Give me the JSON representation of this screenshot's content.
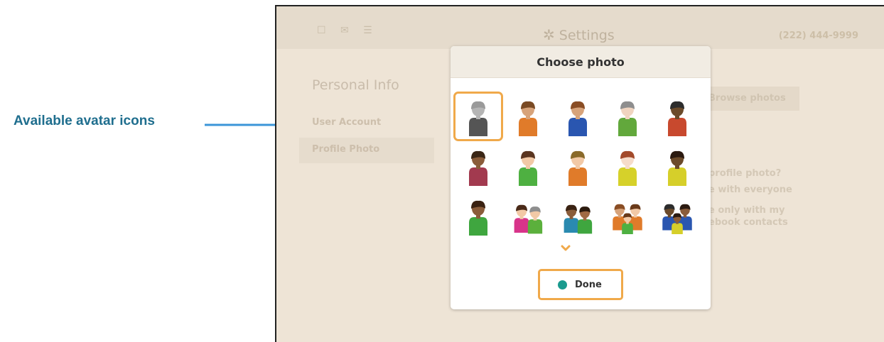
{
  "annotation": {
    "label": "Available avatar icons"
  },
  "app": {
    "title": "Settings",
    "phone": "(222) 444-9999",
    "top_icons": "☐ ✉ ☰",
    "sidebar_heading": "Personal Info",
    "sidebar_items": [
      "User Account",
      "Profile Photo"
    ],
    "browse_button": "Browse photos",
    "privacy_question": "profile photo?",
    "privacy_option_1": "e with everyone",
    "privacy_option_2_line1": "e only with my",
    "privacy_option_2_line2": "ebook contacts"
  },
  "dialog": {
    "title": "Choose photo",
    "done_label": "Done",
    "selected_index": 0,
    "avatars": [
      {
        "name": "default-gray-avatar",
        "kind": "default",
        "skin": "#b5b5b5",
        "hair": "#9a9a9a",
        "shirt": "#555555"
      },
      {
        "name": "avatar-brown-hair-orange-shirt",
        "kind": "single",
        "skin": "#d7a37a",
        "hair": "#7a4a24",
        "shirt": "#e07b2a"
      },
      {
        "name": "avatar-brown-hair-blue-shirt",
        "kind": "single",
        "skin": "#d7a37a",
        "hair": "#8a4d24",
        "shirt": "#2a56b0"
      },
      {
        "name": "avatar-gray-hair-green-shirt",
        "kind": "single",
        "skin": "#f0d4c0",
        "hair": "#8e8e8e",
        "shirt": "#62a83c"
      },
      {
        "name": "avatar-dark-skin-red-shirt",
        "kind": "single",
        "skin": "#6b4a2a",
        "hair": "#2c2c2c",
        "shirt": "#c8492e"
      },
      {
        "name": "avatar-brown-skin-maroon-shirt",
        "kind": "single",
        "skin": "#8a5c3a",
        "hair": "#3a2616",
        "shirt": "#a23a4f"
      },
      {
        "name": "avatar-woman-green-shirt",
        "kind": "single",
        "skin": "#f2c9a6",
        "hair": "#5a3520",
        "shirt": "#4eb041"
      },
      {
        "name": "avatar-woman-ponytail-orange-shirt",
        "kind": "single",
        "skin": "#f2c9a6",
        "hair": "#8a6a2a",
        "shirt": "#e07b2a"
      },
      {
        "name": "avatar-woman-red-hair-yellow-shirt",
        "kind": "single",
        "skin": "#f6dcca",
        "hair": "#a34a2a",
        "shirt": "#d6d12a"
      },
      {
        "name": "avatar-dark-skin-woman-yellow-shirt",
        "kind": "single",
        "skin": "#6b4a2a",
        "hair": "#2b1a10",
        "shirt": "#d6cf2a"
      },
      {
        "name": "avatar-brown-woman-green-shirt",
        "kind": "single",
        "skin": "#8a5c3a",
        "hair": "#3a2212",
        "shirt": "#3fa63f"
      },
      {
        "name": "avatar-couple-pink-green",
        "kind": "pair",
        "skin": "#f2c9a6",
        "hair": "#4a2a18",
        "shirt": "#d8348a",
        "skin2": "#f2c9a6",
        "hair2": "#8e8e8e",
        "shirt2": "#5bb03c"
      },
      {
        "name": "avatar-couple-blue-green",
        "kind": "pair",
        "skin": "#8a5c3a",
        "hair": "#3a2212",
        "shirt": "#2a8ab0",
        "skin2": "#a06a44",
        "hair2": "#2c1a0e",
        "shirt2": "#3fa63f"
      },
      {
        "name": "avatar-family-orange",
        "kind": "trio",
        "skin": "#d7a37a",
        "hair": "#8a4d24",
        "shirt": "#e07b2a",
        "skin2": "#f2c9a6",
        "hair2": "#6a3a1a",
        "shirt2": "#4eb041"
      },
      {
        "name": "avatar-family-blue-yellow",
        "kind": "trio",
        "skin": "#6b4a2a",
        "hair": "#2c2c2c",
        "shirt": "#2a56b0",
        "skin2": "#8a5c3a",
        "hair2": "#2b1a10",
        "shirt2": "#d6cf2a"
      }
    ]
  }
}
